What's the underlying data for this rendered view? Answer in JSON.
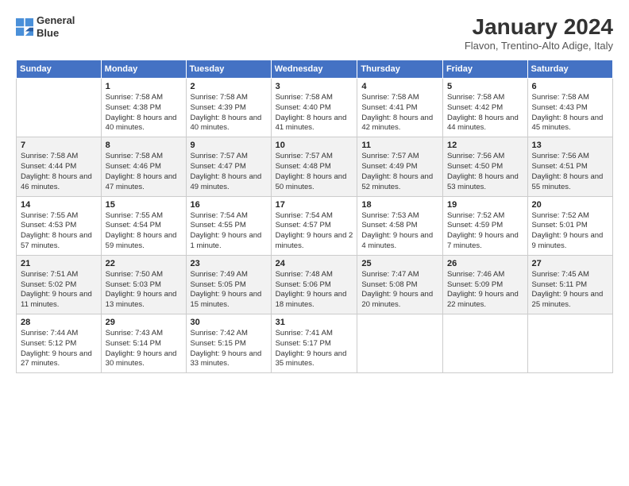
{
  "logo": {
    "line1": "General",
    "line2": "Blue"
  },
  "title": "January 2024",
  "location": "Flavon, Trentino-Alto Adige, Italy",
  "weekdays": [
    "Sunday",
    "Monday",
    "Tuesday",
    "Wednesday",
    "Thursday",
    "Friday",
    "Saturday"
  ],
  "weeks": [
    [
      {
        "day": "",
        "sunrise": "",
        "sunset": "",
        "daylight": ""
      },
      {
        "day": "1",
        "sunrise": "Sunrise: 7:58 AM",
        "sunset": "Sunset: 4:38 PM",
        "daylight": "Daylight: 8 hours and 40 minutes."
      },
      {
        "day": "2",
        "sunrise": "Sunrise: 7:58 AM",
        "sunset": "Sunset: 4:39 PM",
        "daylight": "Daylight: 8 hours and 40 minutes."
      },
      {
        "day": "3",
        "sunrise": "Sunrise: 7:58 AM",
        "sunset": "Sunset: 4:40 PM",
        "daylight": "Daylight: 8 hours and 41 minutes."
      },
      {
        "day": "4",
        "sunrise": "Sunrise: 7:58 AM",
        "sunset": "Sunset: 4:41 PM",
        "daylight": "Daylight: 8 hours and 42 minutes."
      },
      {
        "day": "5",
        "sunrise": "Sunrise: 7:58 AM",
        "sunset": "Sunset: 4:42 PM",
        "daylight": "Daylight: 8 hours and 44 minutes."
      },
      {
        "day": "6",
        "sunrise": "Sunrise: 7:58 AM",
        "sunset": "Sunset: 4:43 PM",
        "daylight": "Daylight: 8 hours and 45 minutes."
      }
    ],
    [
      {
        "day": "7",
        "sunrise": "Sunrise: 7:58 AM",
        "sunset": "Sunset: 4:44 PM",
        "daylight": "Daylight: 8 hours and 46 minutes."
      },
      {
        "day": "8",
        "sunrise": "Sunrise: 7:58 AM",
        "sunset": "Sunset: 4:46 PM",
        "daylight": "Daylight: 8 hours and 47 minutes."
      },
      {
        "day": "9",
        "sunrise": "Sunrise: 7:57 AM",
        "sunset": "Sunset: 4:47 PM",
        "daylight": "Daylight: 8 hours and 49 minutes."
      },
      {
        "day": "10",
        "sunrise": "Sunrise: 7:57 AM",
        "sunset": "Sunset: 4:48 PM",
        "daylight": "Daylight: 8 hours and 50 minutes."
      },
      {
        "day": "11",
        "sunrise": "Sunrise: 7:57 AM",
        "sunset": "Sunset: 4:49 PM",
        "daylight": "Daylight: 8 hours and 52 minutes."
      },
      {
        "day": "12",
        "sunrise": "Sunrise: 7:56 AM",
        "sunset": "Sunset: 4:50 PM",
        "daylight": "Daylight: 8 hours and 53 minutes."
      },
      {
        "day": "13",
        "sunrise": "Sunrise: 7:56 AM",
        "sunset": "Sunset: 4:51 PM",
        "daylight": "Daylight: 8 hours and 55 minutes."
      }
    ],
    [
      {
        "day": "14",
        "sunrise": "Sunrise: 7:55 AM",
        "sunset": "Sunset: 4:53 PM",
        "daylight": "Daylight: 8 hours and 57 minutes."
      },
      {
        "day": "15",
        "sunrise": "Sunrise: 7:55 AM",
        "sunset": "Sunset: 4:54 PM",
        "daylight": "Daylight: 8 hours and 59 minutes."
      },
      {
        "day": "16",
        "sunrise": "Sunrise: 7:54 AM",
        "sunset": "Sunset: 4:55 PM",
        "daylight": "Daylight: 9 hours and 1 minute."
      },
      {
        "day": "17",
        "sunrise": "Sunrise: 7:54 AM",
        "sunset": "Sunset: 4:57 PM",
        "daylight": "Daylight: 9 hours and 2 minutes."
      },
      {
        "day": "18",
        "sunrise": "Sunrise: 7:53 AM",
        "sunset": "Sunset: 4:58 PM",
        "daylight": "Daylight: 9 hours and 4 minutes."
      },
      {
        "day": "19",
        "sunrise": "Sunrise: 7:52 AM",
        "sunset": "Sunset: 4:59 PM",
        "daylight": "Daylight: 9 hours and 7 minutes."
      },
      {
        "day": "20",
        "sunrise": "Sunrise: 7:52 AM",
        "sunset": "Sunset: 5:01 PM",
        "daylight": "Daylight: 9 hours and 9 minutes."
      }
    ],
    [
      {
        "day": "21",
        "sunrise": "Sunrise: 7:51 AM",
        "sunset": "Sunset: 5:02 PM",
        "daylight": "Daylight: 9 hours and 11 minutes."
      },
      {
        "day": "22",
        "sunrise": "Sunrise: 7:50 AM",
        "sunset": "Sunset: 5:03 PM",
        "daylight": "Daylight: 9 hours and 13 minutes."
      },
      {
        "day": "23",
        "sunrise": "Sunrise: 7:49 AM",
        "sunset": "Sunset: 5:05 PM",
        "daylight": "Daylight: 9 hours and 15 minutes."
      },
      {
        "day": "24",
        "sunrise": "Sunrise: 7:48 AM",
        "sunset": "Sunset: 5:06 PM",
        "daylight": "Daylight: 9 hours and 18 minutes."
      },
      {
        "day": "25",
        "sunrise": "Sunrise: 7:47 AM",
        "sunset": "Sunset: 5:08 PM",
        "daylight": "Daylight: 9 hours and 20 minutes."
      },
      {
        "day": "26",
        "sunrise": "Sunrise: 7:46 AM",
        "sunset": "Sunset: 5:09 PM",
        "daylight": "Daylight: 9 hours and 22 minutes."
      },
      {
        "day": "27",
        "sunrise": "Sunrise: 7:45 AM",
        "sunset": "Sunset: 5:11 PM",
        "daylight": "Daylight: 9 hours and 25 minutes."
      }
    ],
    [
      {
        "day": "28",
        "sunrise": "Sunrise: 7:44 AM",
        "sunset": "Sunset: 5:12 PM",
        "daylight": "Daylight: 9 hours and 27 minutes."
      },
      {
        "day": "29",
        "sunrise": "Sunrise: 7:43 AM",
        "sunset": "Sunset: 5:14 PM",
        "daylight": "Daylight: 9 hours and 30 minutes."
      },
      {
        "day": "30",
        "sunrise": "Sunrise: 7:42 AM",
        "sunset": "Sunset: 5:15 PM",
        "daylight": "Daylight: 9 hours and 33 minutes."
      },
      {
        "day": "31",
        "sunrise": "Sunrise: 7:41 AM",
        "sunset": "Sunset: 5:17 PM",
        "daylight": "Daylight: 9 hours and 35 minutes."
      },
      {
        "day": "",
        "sunrise": "",
        "sunset": "",
        "daylight": ""
      },
      {
        "day": "",
        "sunrise": "",
        "sunset": "",
        "daylight": ""
      },
      {
        "day": "",
        "sunrise": "",
        "sunset": "",
        "daylight": ""
      }
    ]
  ]
}
